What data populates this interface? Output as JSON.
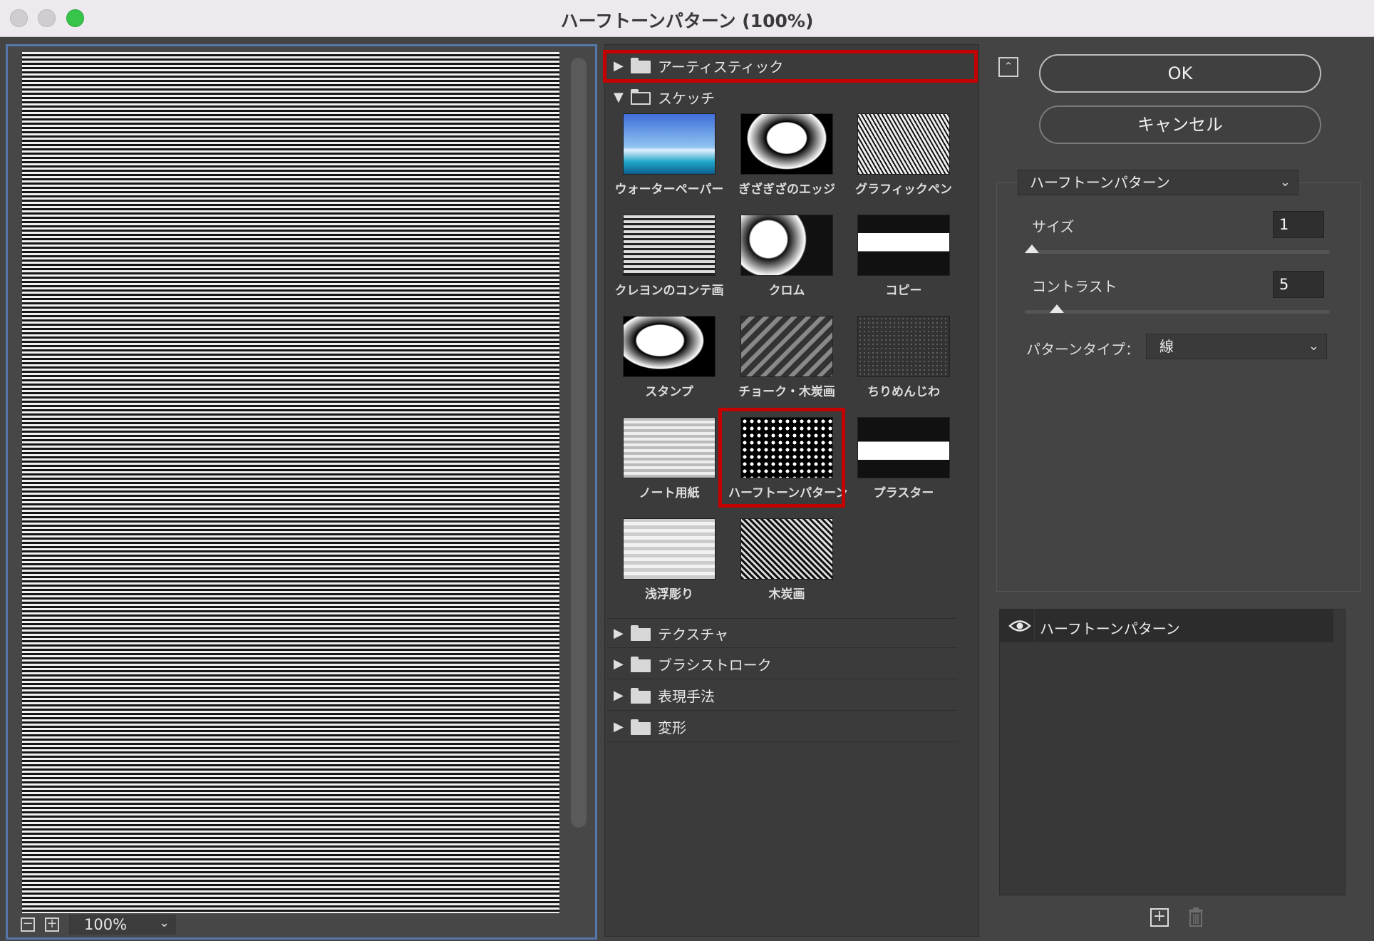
{
  "window": {
    "title": "ハーフトーンパターン (100%)"
  },
  "preview": {
    "zoom": "100%",
    "zoom_minus": "−",
    "zoom_plus": "+"
  },
  "categories": {
    "artistic": "アーティスティック",
    "sketch": "スケッチ",
    "texture": "テクスチャ",
    "brush_strokes": "ブラシストローク",
    "stylize": "表現手法",
    "distort": "変形"
  },
  "sketch_filters": [
    {
      "label": "ウォーターペーパー"
    },
    {
      "label": "ぎざぎざのエッジ"
    },
    {
      "label": "グラフィックペン"
    },
    {
      "label": "クレヨンのコンテ画"
    },
    {
      "label": "クロム"
    },
    {
      "label": "コピー"
    },
    {
      "label": "スタンプ"
    },
    {
      "label": "チョーク・木炭画"
    },
    {
      "label": "ちりめんじわ"
    },
    {
      "label": "ノート用紙"
    },
    {
      "label": "ハーフトーンパターン"
    },
    {
      "label": "プラスター"
    },
    {
      "label": "浅浮彫り"
    },
    {
      "label": "木炭画"
    }
  ],
  "buttons": {
    "ok": "OK",
    "cancel": "キャンセル",
    "collapse": "⌃"
  },
  "settings": {
    "filter_name": "ハーフトーンパターン",
    "size_label": "サイズ",
    "size_value": "1",
    "size_level": 0.0,
    "contrast_label": "コントラスト",
    "contrast_value": "5",
    "contrast_level": 0.1,
    "pattern_type_label": "パターンタイプ：",
    "pattern_type_value": "線"
  },
  "layers": [
    {
      "name": "ハーフトーンパターン",
      "visible": true
    }
  ],
  "icons": {
    "eye": "eye-icon",
    "new_layer": "new-effect-layer-icon",
    "delete": "trash-icon"
  }
}
